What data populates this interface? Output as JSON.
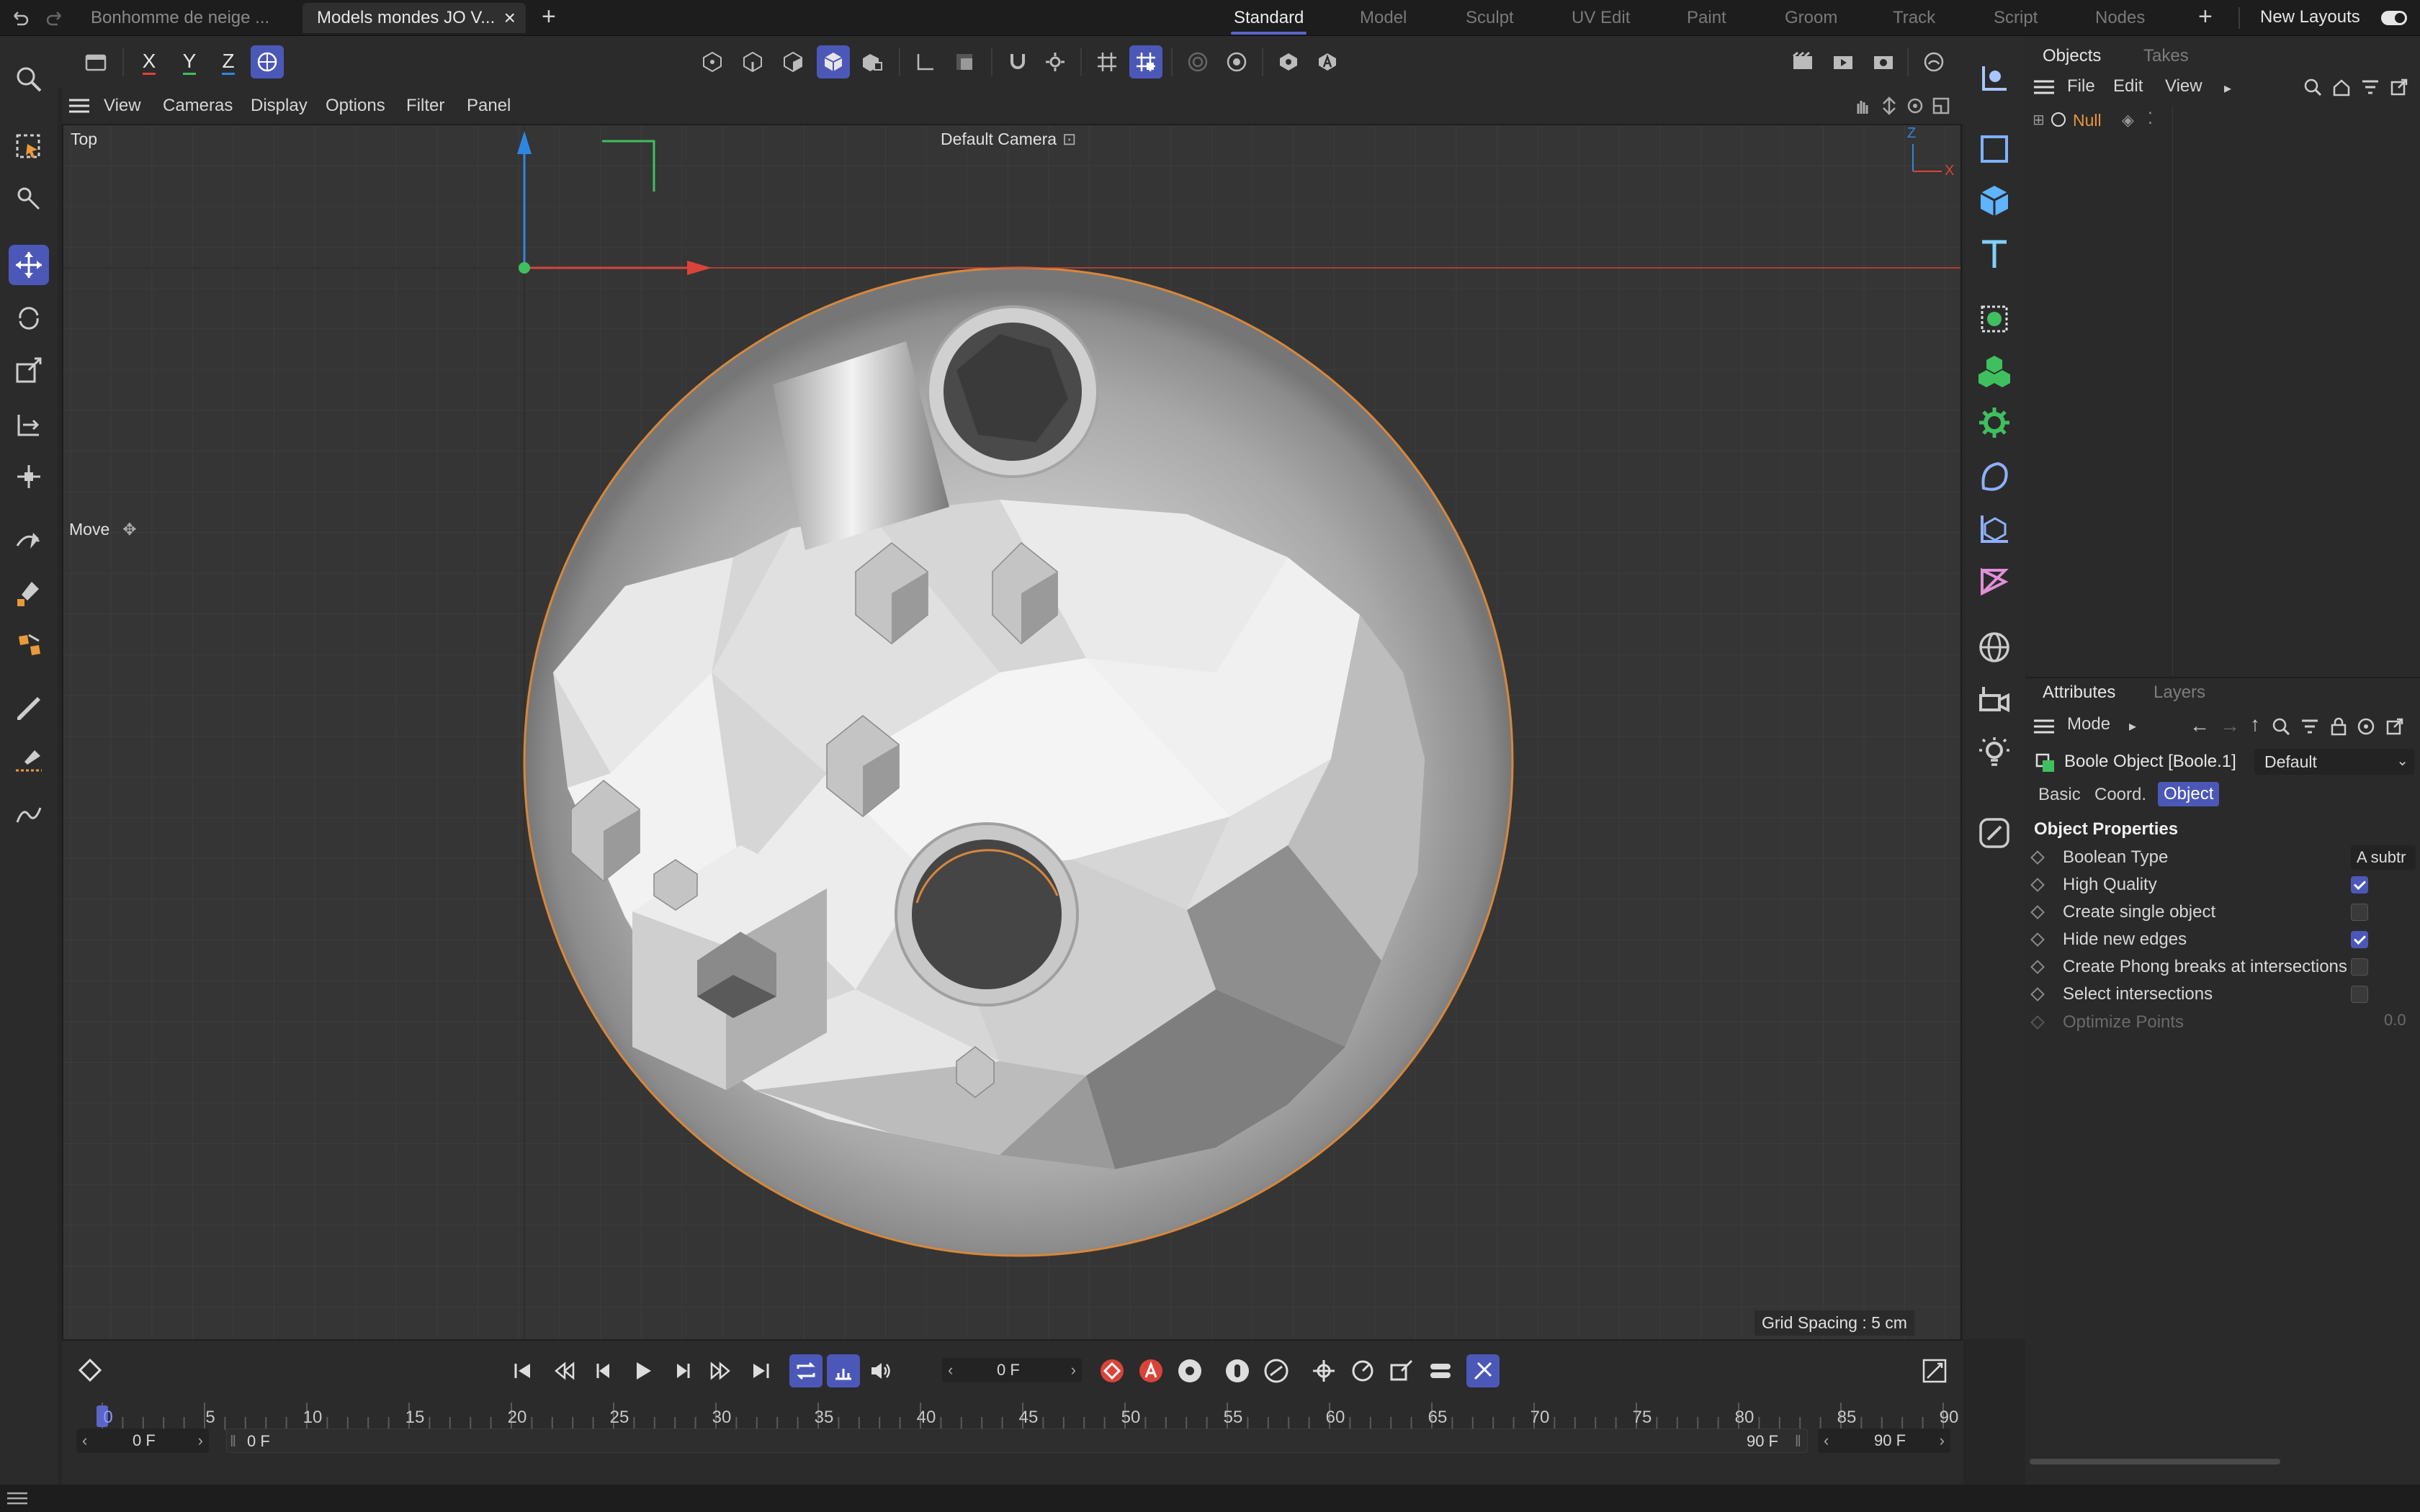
{
  "tabs": {
    "doc1": "Bonhomme de neige ...",
    "doc2": "Models mondes JO V...",
    "close": "×",
    "add": "+"
  },
  "layouts": {
    "items": [
      "Standard",
      "Model",
      "Sculpt",
      "UV Edit",
      "Paint",
      "Groom",
      "Track",
      "Script",
      "Nodes"
    ],
    "add": "+",
    "new_layouts": "New Layouts"
  },
  "axes": {
    "x": "X",
    "y": "Y",
    "z": "Z"
  },
  "viewport_menu": [
    "View",
    "Cameras",
    "Display",
    "Options",
    "Filter",
    "Panel"
  ],
  "viewport": {
    "view_name": "Top",
    "camera": "Default Camera",
    "hud_tool": "Move",
    "grid_spacing": "Grid Spacing : 5 cm",
    "axis_z": "Z",
    "axis_x": "X"
  },
  "objects_panel": {
    "tabs": [
      "Objects",
      "Takes"
    ],
    "menu": [
      "File",
      "Edit",
      "View"
    ],
    "item": "Null"
  },
  "attributes_panel": {
    "tabs": [
      "Attributes",
      "Layers"
    ],
    "mode": "Mode",
    "object_name": "Boole Object [Boole.1]",
    "preset": "Default",
    "subtabs": [
      "Basic",
      "Coord.",
      "Object"
    ],
    "section": "Object Properties",
    "props": [
      {
        "label": "Boolean Type",
        "value": "A subtr"
      },
      {
        "label": "High Quality",
        "checked": true
      },
      {
        "label": "Create single object",
        "checked": false
      },
      {
        "label": "Hide new edges",
        "checked": true
      },
      {
        "label": "Create Phong breaks at intersections",
        "checked": false
      },
      {
        "label": "Select intersections",
        "checked": false
      },
      {
        "label": "Optimize Points",
        "value": "0.0"
      }
    ]
  },
  "timeline": {
    "current_frame": "0 F",
    "ticks": [
      "0",
      "5",
      "10",
      "15",
      "20",
      "25",
      "30",
      "35",
      "40",
      "45",
      "50",
      "55",
      "60",
      "65",
      "70",
      "75",
      "80",
      "85",
      "90"
    ],
    "start": "0 F",
    "range_start": "0 F",
    "range_end": "90 F",
    "end": "90 F"
  },
  "colors": {
    "accent": "#4c58b8",
    "axis_x": "#d9443a",
    "axis_y": "#2f86e0",
    "axis_green": "#3fbf5f",
    "selection": "#d8873a"
  }
}
